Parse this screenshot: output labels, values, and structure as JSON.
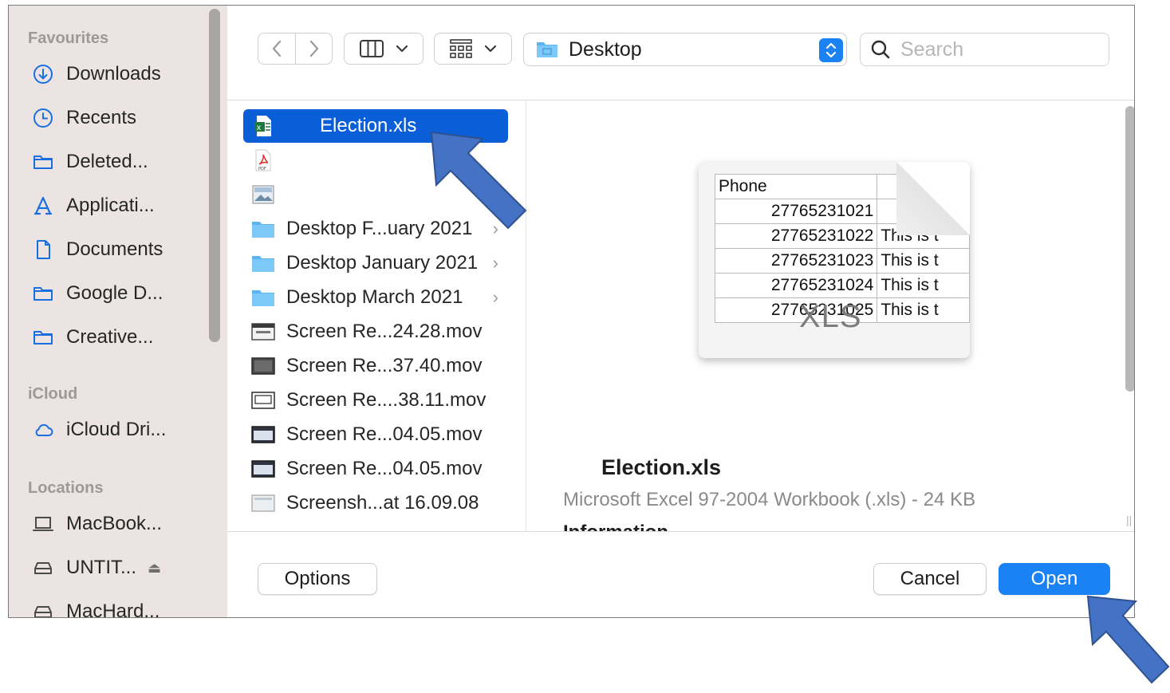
{
  "sidebar": {
    "sections": [
      {
        "heading": "Favourites",
        "items": [
          {
            "label": "Downloads",
            "icon": "download-icon"
          },
          {
            "label": "Recents",
            "icon": "clock-icon"
          },
          {
            "label": "Deleted...",
            "icon": "folder-icon"
          },
          {
            "label": "Applicati...",
            "icon": "applications-icon"
          },
          {
            "label": "Documents",
            "icon": "document-icon"
          },
          {
            "label": "Google D...",
            "icon": "folder-icon"
          },
          {
            "label": "Creative...",
            "icon": "folder-icon"
          }
        ]
      },
      {
        "heading": "iCloud",
        "items": [
          {
            "label": "iCloud Dri...",
            "icon": "cloud-icon"
          }
        ]
      },
      {
        "heading": "Locations",
        "items": [
          {
            "label": "MacBook...",
            "icon": "laptop-icon"
          },
          {
            "label": "UNTIT...",
            "icon": "drive-icon",
            "eject": "⏏"
          },
          {
            "label": "MacHard...",
            "icon": "drive-icon"
          }
        ]
      }
    ]
  },
  "toolbar": {
    "location": "Desktop",
    "search_placeholder": "Search"
  },
  "files": [
    {
      "label": "Election.xls",
      "icon": "excel-file-icon",
      "selected": true
    },
    {
      "label": "",
      "icon": "pdf-file-icon"
    },
    {
      "label": "",
      "icon": "image-file-icon"
    },
    {
      "label": "Desktop F...uary 2021",
      "icon": "folder-icon",
      "chevron": "›"
    },
    {
      "label": "Desktop January 2021",
      "icon": "folder-icon",
      "chevron": "›"
    },
    {
      "label": "Desktop March 2021",
      "icon": "folder-icon",
      "chevron": "›"
    },
    {
      "label": "Screen Re...24.28.mov",
      "icon": "video-file-icon"
    },
    {
      "label": "Screen Re...37.40.mov",
      "icon": "video-file-icon"
    },
    {
      "label": "Screen Re....38.11.mov",
      "icon": "video-file-icon"
    },
    {
      "label": "Screen Re...04.05.mov",
      "icon": "video-file-icon"
    },
    {
      "label": "Screen Re...04.05.mov",
      "icon": "video-file-icon"
    },
    {
      "label": "Screensh...at 16.09.08",
      "icon": "image-file-icon"
    }
  ],
  "preview": {
    "name": "Election.xls",
    "kind": "Microsoft Excel 97-2004 Workbook (.xls) - 24 KB",
    "info_heading": "Information",
    "thumbnail": {
      "header": "Phone",
      "rows": [
        {
          "num": "27765231021",
          "text": ""
        },
        {
          "num": "27765231022",
          "text": "This is t"
        },
        {
          "num": "27765231023",
          "text": "This is t"
        },
        {
          "num": "27765231024",
          "text": "This is t"
        },
        {
          "num": "27765231025",
          "text": "This is t"
        }
      ],
      "badge": "XLS"
    }
  },
  "buttons": {
    "options": "Options",
    "cancel": "Cancel",
    "open": "Open"
  },
  "colors": {
    "accent": "#1a82f2",
    "selection": "#0a5fd8",
    "sidebar_bg": "#ebe4e2",
    "annotation_arrow": "#4472c4"
  }
}
